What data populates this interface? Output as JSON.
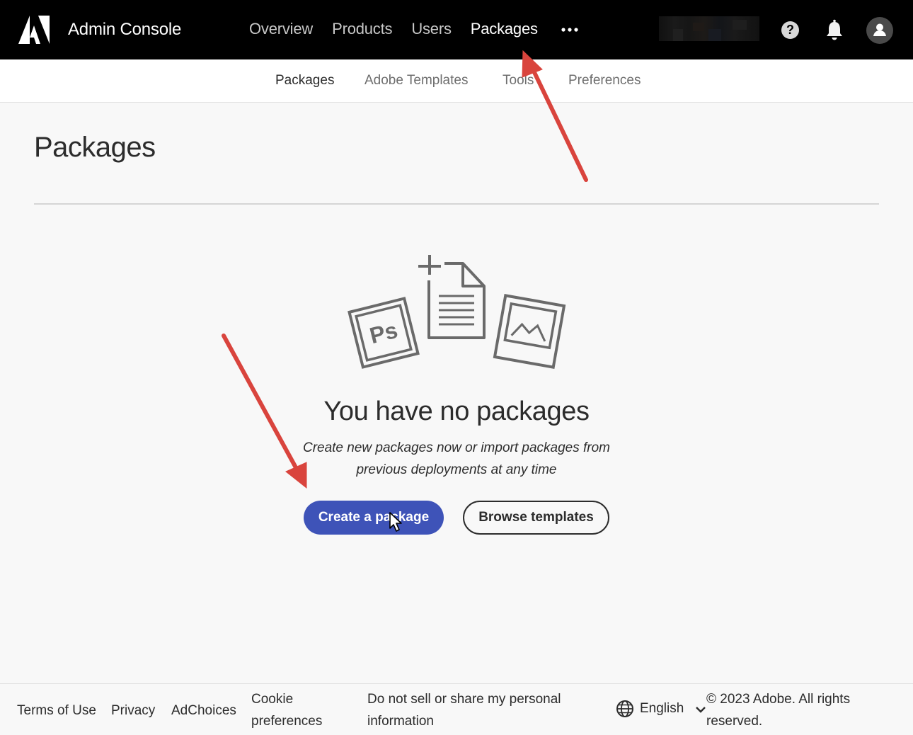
{
  "header": {
    "app_title": "Admin Console",
    "nav": [
      "Overview",
      "Products",
      "Users",
      "Packages"
    ],
    "active_nav": "Packages",
    "more_icon": "ellipsis-icon",
    "help_symbol": "?",
    "icons": [
      "adobe-logo-icon",
      "help-icon",
      "bell-icon",
      "user-avatar-icon"
    ]
  },
  "subnav": {
    "items": [
      "Packages",
      "Adobe Templates",
      "Tools",
      "Preferences"
    ],
    "active": "Packages"
  },
  "page": {
    "title": "Packages"
  },
  "empty_state": {
    "heading": "You have no packages",
    "description": "Create new packages now or import packages from previous deployments at any time",
    "illustration_text": "Ps",
    "primary_button": "Create a package",
    "secondary_button": "Browse templates"
  },
  "footer": {
    "links": [
      "Terms of Use",
      "Privacy",
      "AdChoices",
      "Cookie preferences",
      "Do not sell or share my personal information"
    ],
    "language": "English",
    "copyright": "© 2023 Adobe. All rights reserved."
  },
  "annotations": {
    "arrow_color": "#d9443d"
  },
  "colors": {
    "topbar": "#000000",
    "primary_button": "#3e53b8",
    "page_bg": "#f8f8f8"
  }
}
